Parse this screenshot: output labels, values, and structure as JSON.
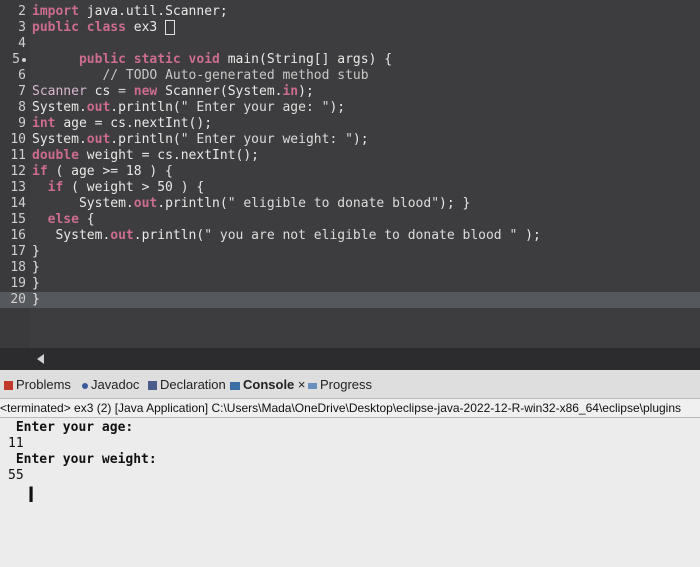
{
  "editor": {
    "lines": [
      {
        "n": "2",
        "parts": [
          [
            "kw",
            "import "
          ],
          [
            "fn",
            "java.util.Scanner;"
          ]
        ]
      },
      {
        "n": "3",
        "parts": [
          [
            "kw",
            "public class "
          ],
          [
            "fn",
            "ex3 "
          ]
        ],
        "box": true
      },
      {
        "n": "4",
        "parts": []
      },
      {
        "n": "5",
        "parts": [
          [
            "",
            "      "
          ],
          [
            "kw",
            "public static void "
          ],
          [
            "fn",
            "main(String[] args) {"
          ]
        ],
        "marker": true
      },
      {
        "n": "6",
        "parts": [
          [
            "",
            "         "
          ],
          [
            "cm",
            "// TODO Auto-generated method stub"
          ]
        ]
      },
      {
        "n": "7",
        "parts": [
          [
            "ty",
            "Scanner "
          ],
          [
            "fn",
            "cs "
          ],
          [
            "",
            "= "
          ],
          [
            "kw",
            "new "
          ],
          [
            "fn",
            "Scanner(System."
          ],
          [
            "kw",
            "in"
          ],
          [
            "fn",
            ");"
          ]
        ]
      },
      {
        "n": "8",
        "parts": [
          [
            "fn",
            "System."
          ],
          [
            "kw",
            "out"
          ],
          [
            "fn",
            ".println("
          ],
          [
            "st",
            "\" Enter your age: \""
          ],
          [
            "fn",
            ");"
          ]
        ]
      },
      {
        "n": "9",
        "parts": [
          [
            "kw",
            "int "
          ],
          [
            "fn",
            "age = cs.nextInt();"
          ]
        ]
      },
      {
        "n": "10",
        "parts": [
          [
            "fn",
            "System."
          ],
          [
            "kw",
            "out"
          ],
          [
            "fn",
            ".println("
          ],
          [
            "st",
            "\" Enter your weight: \""
          ],
          [
            "fn",
            ");"
          ]
        ]
      },
      {
        "n": "11",
        "parts": [
          [
            "kw",
            "double "
          ],
          [
            "fn",
            "weight = cs.nextInt();"
          ]
        ]
      },
      {
        "n": "12",
        "parts": [
          [
            "kw",
            "if "
          ],
          [
            "fn",
            "( age >= 18 ) {"
          ]
        ]
      },
      {
        "n": "13",
        "parts": [
          [
            "",
            "  "
          ],
          [
            "kw",
            "if "
          ],
          [
            "fn",
            "( weight > 50 ) {"
          ]
        ]
      },
      {
        "n": "14",
        "parts": [
          [
            "",
            "      "
          ],
          [
            "fn",
            "System."
          ],
          [
            "kw",
            "out"
          ],
          [
            "fn",
            ".println("
          ],
          [
            "st",
            "\" eligible to donate blood\""
          ],
          [
            "fn",
            "); }"
          ]
        ]
      },
      {
        "n": "15",
        "parts": [
          [
            "",
            "  "
          ],
          [
            "kw",
            "else "
          ],
          [
            "fn",
            "{"
          ]
        ]
      },
      {
        "n": "16",
        "parts": [
          [
            "",
            "   "
          ],
          [
            "fn",
            "System."
          ],
          [
            "kw",
            "out"
          ],
          [
            "fn",
            ".println("
          ],
          [
            "st",
            "\" you are not eligible to donate blood \""
          ],
          [
            "fn",
            " );"
          ]
        ]
      },
      {
        "n": "17",
        "parts": [
          [
            "fn",
            "}"
          ]
        ]
      },
      {
        "n": "18",
        "parts": [
          [
            "fn",
            "}"
          ]
        ]
      },
      {
        "n": "19",
        "parts": [
          [
            "fn",
            "}"
          ]
        ]
      },
      {
        "n": "20",
        "parts": [
          [
            "fn",
            "}"
          ]
        ],
        "highlight": true
      }
    ]
  },
  "tabs": {
    "problems": "Problems",
    "javadoc": "Javadoc",
    "declaration": "Declaration",
    "console": "Console",
    "close": "×",
    "progress": "Progress"
  },
  "status": {
    "text": "<terminated> ex3 (2) [Java Application] C:\\Users\\Mada\\OneDrive\\Desktop\\eclipse-java-2022-12-R-win32-x86_64\\eclipse\\plugins"
  },
  "console": {
    "lines": [
      {
        "text": " Enter your age:",
        "bold": true
      },
      {
        "text": "11",
        "bold": false
      },
      {
        "text": " Enter your weight:",
        "bold": true
      },
      {
        "text": "55",
        "bold": false
      }
    ],
    "caret": "I"
  },
  "colors": {
    "editor_bg": "#3d3d3f",
    "keyword": "#cc6c8e",
    "console_bg": "#ececec"
  }
}
